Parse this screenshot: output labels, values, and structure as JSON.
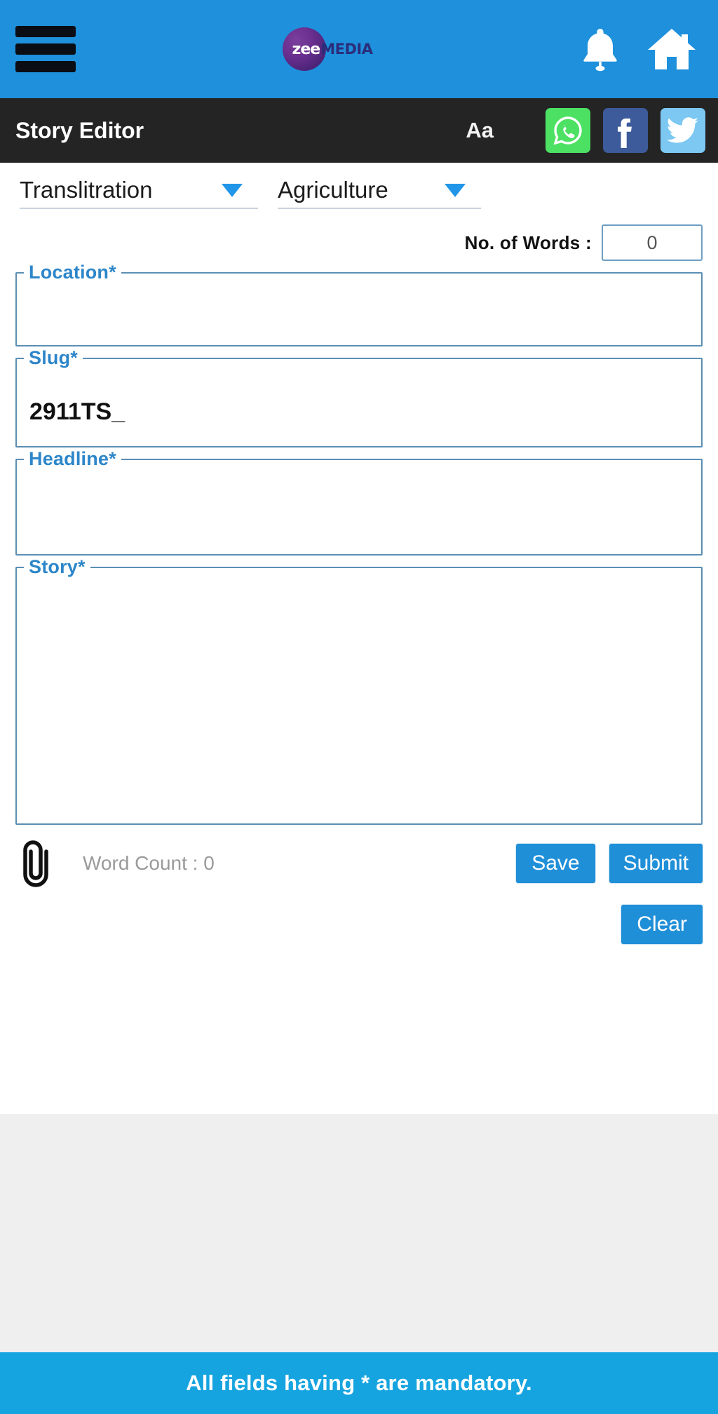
{
  "header": {
    "menu_icon": "hamburger-menu-icon",
    "brand_zee": "zee",
    "brand_media": "MEDIA",
    "notification_icon": "bell-icon",
    "home_icon": "home-icon",
    "background_color": "#1e90dc"
  },
  "toolbar": {
    "title": "Story Editor",
    "font_size_label": "Aa",
    "share": [
      {
        "name": "whatsapp",
        "color": "#4ce163"
      },
      {
        "name": "facebook",
        "color": "#3d5a9a"
      },
      {
        "name": "twitter",
        "color": "#7cc8f2"
      }
    ],
    "background_color": "#242424"
  },
  "form": {
    "language_select": {
      "value": "Translitration",
      "caret_icon": "chevron-down-icon"
    },
    "category_select": {
      "value": "Agriculture",
      "caret_icon": "chevron-down-icon"
    },
    "no_of_words": {
      "label": "No. of Words :",
      "value": "0"
    },
    "fields": {
      "location": {
        "legend": "Location",
        "required_mark": "*",
        "value": "",
        "placeholder": ""
      },
      "slug": {
        "legend": "Slug",
        "required_mark": "*",
        "value": "2911TS_",
        "placeholder": ""
      },
      "headline": {
        "legend": "Headline",
        "required_mark": "*",
        "value": "",
        "placeholder": ""
      },
      "story": {
        "legend": "Story",
        "required_mark": "*",
        "value": "",
        "placeholder": ""
      }
    },
    "attach_icon": "paperclip-icon",
    "word_count": {
      "label": "Word Count :",
      "value": "0",
      "full": "Word Count :  0"
    },
    "buttons": {
      "save": "Save",
      "submit": "Submit",
      "clear": "Clear",
      "accent_color": "#1f8fd8"
    }
  },
  "footer": {
    "message": "All fields having * are mandatory.",
    "background_color": "#16a4e0"
  }
}
